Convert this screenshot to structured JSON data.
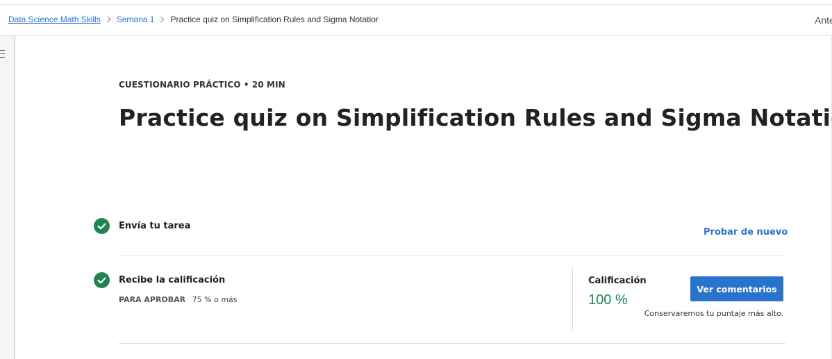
{
  "breadcrumb": {
    "course": "Data Science Math Skills",
    "week": "Semana 1",
    "current": "Practice quiz on Simplification Rules and Sigma Notatior"
  },
  "nav": {
    "previous_label": "Anterior"
  },
  "header": {
    "eyebrow": "CUESTIONARIO PRÁCTICO • 20 MIN",
    "title": "Practice quiz on Simplification Rules and Sigma Notation"
  },
  "steps": [
    {
      "label": "Envía tu tarea",
      "status": "complete",
      "action_label": "Probar de nuevo"
    },
    {
      "label": "Recibe la calificación",
      "status": "complete",
      "pass_label": "PARA APROBAR",
      "pass_value": "75 % o más"
    }
  ],
  "grade": {
    "label": "Calificación",
    "value": "100 %",
    "button_label": "Ver comentarios",
    "note": "Conservaremos tu puntaje más alto."
  },
  "colors": {
    "accent": "#2a73cc",
    "success": "#1f8354"
  },
  "icons": {
    "menu": "menu-icon",
    "check": "check-circle-icon",
    "chevron": "chevron-right-icon"
  }
}
